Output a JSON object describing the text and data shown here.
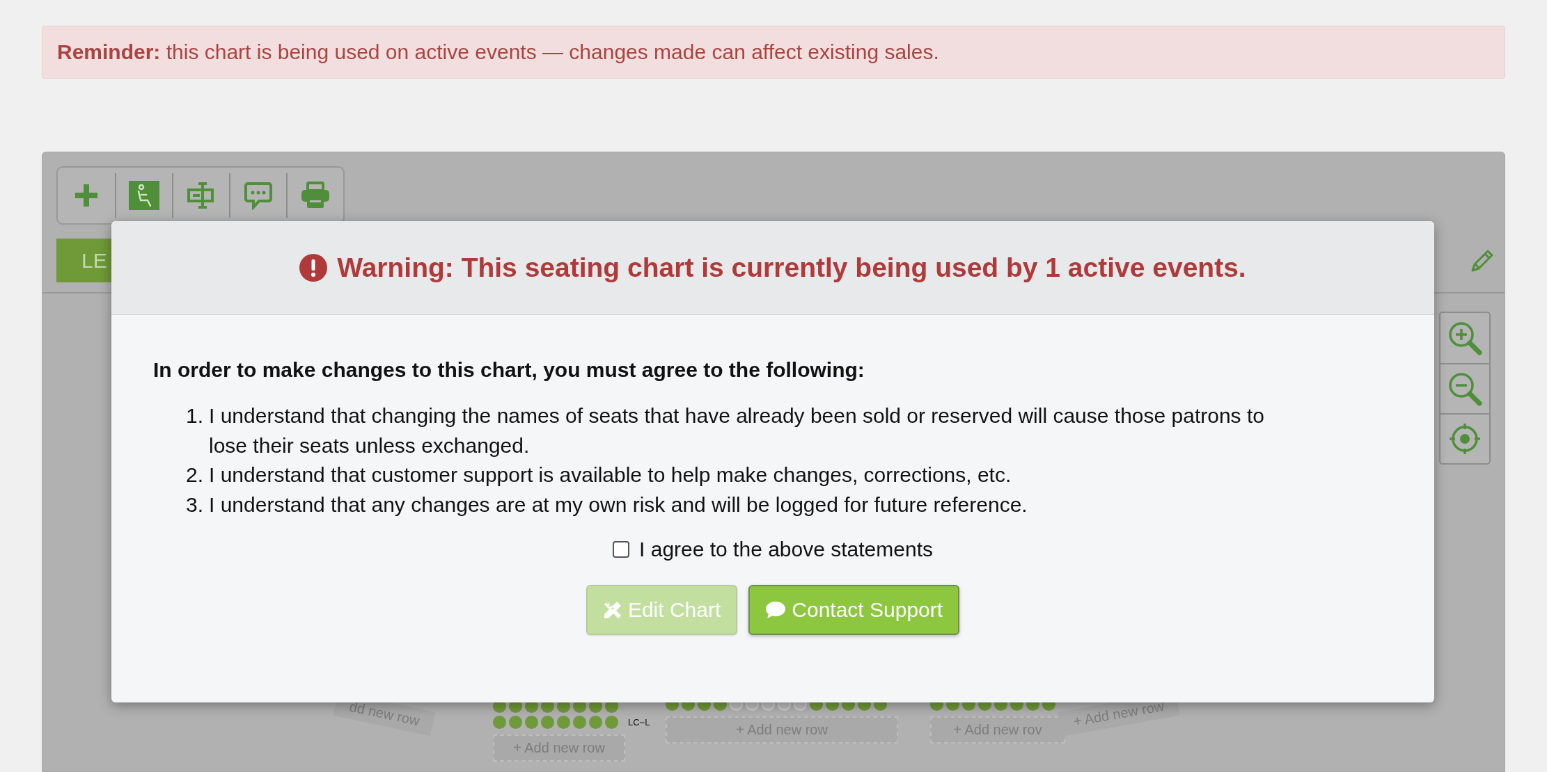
{
  "alert": {
    "text": "**Reminder:** this chart is being used on active events — changes made can affect existing sales."
  },
  "toolbar": [
    {
      "kind": "add",
      "selected": false
    },
    {
      "kind": "seat",
      "selected": true
    },
    {
      "kind": "text",
      "selected": false
    },
    {
      "kind": "comment",
      "selected": false
    },
    {
      "kind": "print",
      "selected": false
    }
  ],
  "legend_button": {
    "label": "LE"
  },
  "modal": {
    "title": "Warning: This seating chart is currently being used by 1 active events.",
    "intro": "In order to make changes to this chart, you must agree to the following:",
    "statements": [
      {
        "number": "1.",
        "text": "I understand that changing the names of seats that have already been sold or reserved will cause those patrons to lose their seats unless exchanged."
      },
      {
        "number": "2.",
        "text": "I understand that customer support is available to help make changes, corrections, etc."
      },
      {
        "number": "3.",
        "text": "I understand that any changes are at my own risk and will be logged for future reference."
      }
    ],
    "agreement": {
      "label": "I agree to the above statements",
      "checked": false
    },
    "buttons": [
      {
        "kind": "edit",
        "label": "Edit Chart",
        "disabled": true
      },
      {
        "kind": "support",
        "label": "Contact Support",
        "disabled": false
      }
    ]
  },
  "seating": {
    "left_curve_label": "dd new row",
    "right_curve_label": "+ Add new row",
    "sections": [
      {
        "rows": [
          {
            "label": "",
            "seats": [
              true,
              true,
              true,
              true,
              true,
              true,
              true,
              true
            ]
          },
          {
            "label": "LC~L",
            "seats": [
              true,
              true,
              true,
              true,
              true,
              true,
              true,
              true
            ]
          }
        ],
        "add_row": "+ Add new row"
      },
      {
        "rows": [
          {
            "label": "",
            "seats": [
              true,
              true,
              true,
              true,
              false,
              false,
              false,
              false,
              false,
              true,
              true,
              true,
              true,
              true
            ]
          }
        ],
        "add_row": "+ Add new row"
      },
      {
        "rows": [
          {
            "label": "",
            "seats": [
              true,
              true,
              true,
              true,
              true,
              true,
              true,
              true
            ]
          }
        ],
        "add_row": "+ Add new rov"
      }
    ]
  }
}
